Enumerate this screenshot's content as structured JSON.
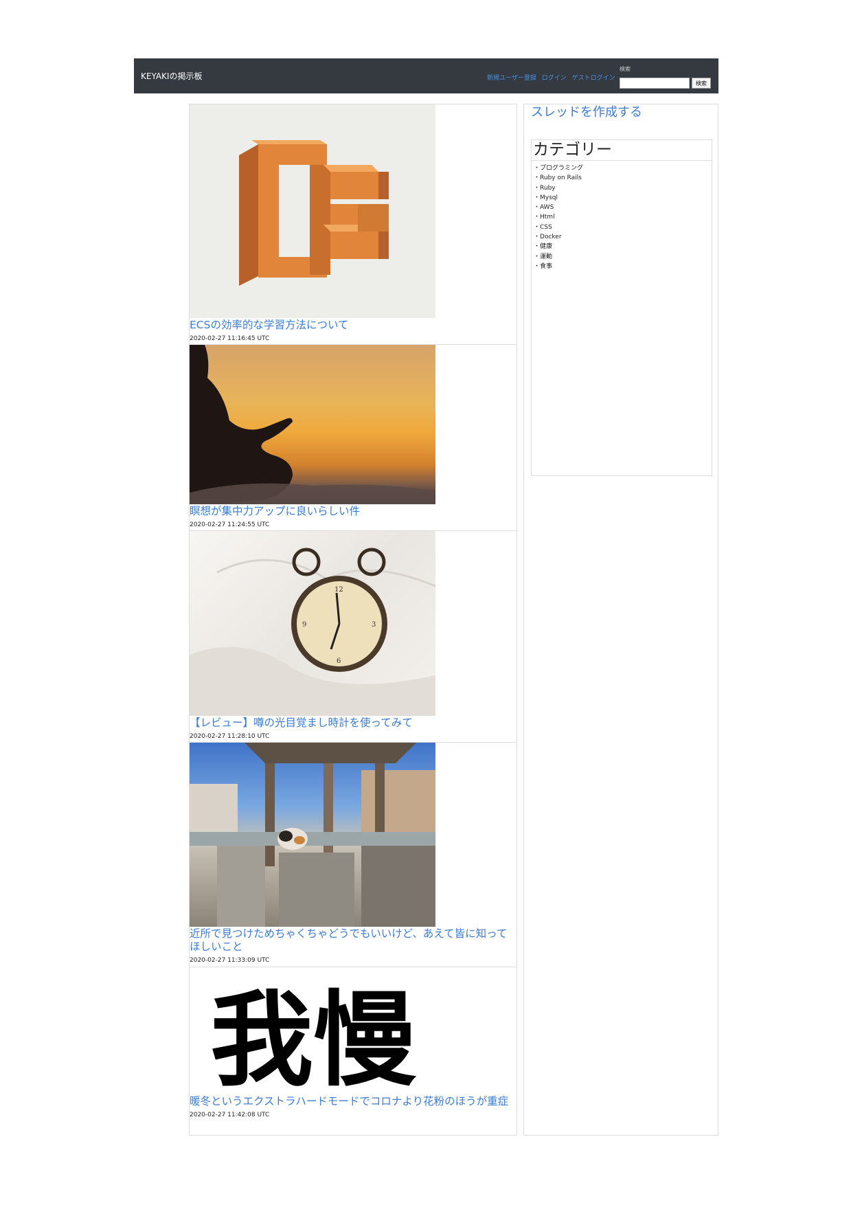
{
  "navbar": {
    "brand": "KEYAKIの掲示板",
    "links": [
      "新規ユーザー登録",
      "ログイン",
      "ゲストログイン"
    ],
    "search_label": "検索",
    "search_value": "",
    "search_button": "検索"
  },
  "posts": [
    {
      "title": "ECSの効率的な学習方法について",
      "date": "2020-02-27 11:16:45 UTC",
      "image": "ecs-logo"
    },
    {
      "title": "瞑想が集中力アップに良いらしい件",
      "date": "2020-02-27 11:24:55 UTC",
      "image": "meditation-sunset"
    },
    {
      "title": "【レビュー】噂の光目覚まし時計を使ってみて",
      "date": "2020-02-27 11:28:10 UTC",
      "image": "alarm-clock"
    },
    {
      "title": "近所で見つけためちゃくちゃどうでもいいけど、あえて皆に知ってほしいこと",
      "date": "2020-02-27 11:33:09 UTC",
      "image": "cat-shrine"
    },
    {
      "title": "暖冬というエクストラハードモードでコロナより花粉のほうが重症",
      "date": "2020-02-27 11:42:08 UTC",
      "image": "calligraphy",
      "image_text": "我慢"
    }
  ],
  "sidebar": {
    "create_thread": "スレッドを作成する",
    "category_title": "カテゴリー",
    "categories": [
      "プログラミング",
      "Ruby on Rails",
      "Ruby",
      "Mysql",
      "AWS",
      "Html",
      "CSS",
      "Docker",
      "健康",
      "運動",
      "食事"
    ]
  },
  "colors": {
    "navbar_bg": "#343a40",
    "link": "#3a7bd5",
    "ecs_orange": "#e0853a"
  }
}
